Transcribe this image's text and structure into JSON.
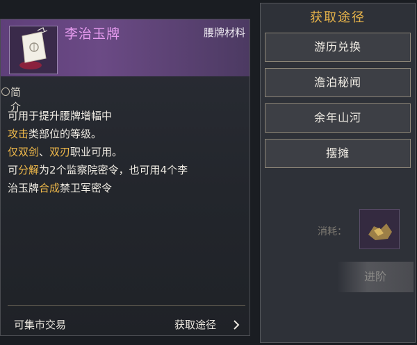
{
  "item": {
    "name": "李治玉牌",
    "category": "腰牌材料",
    "icon": "jade-token-icon",
    "intro_title": "简介",
    "description": [
      [
        {
          "text": "可用于提升腰牌增幅中",
          "hl": false
        }
      ],
      [
        {
          "text": "攻击",
          "hl": true
        },
        {
          "text": "类部位的等级。",
          "hl": false
        }
      ],
      [
        {
          "text": "仅双剑",
          "hl": true
        },
        {
          "text": "、",
          "hl": false
        },
        {
          "text": "双刃",
          "hl": true
        },
        {
          "text": "职业可用。",
          "hl": false
        }
      ],
      [
        {
          "text": "可",
          "hl": false
        },
        {
          "text": "分解",
          "hl": true
        },
        {
          "text": "为2个监察院密令，也可用4个李",
          "hl": false
        }
      ],
      [
        {
          "text": "治玉牌",
          "hl": false
        },
        {
          "text": "合成",
          "hl": true
        },
        {
          "text": "禁卫军密令",
          "hl": false
        }
      ]
    ],
    "footer": {
      "trade_label": "可集市交易",
      "source_label": "获取途径"
    }
  },
  "sources": {
    "title": "获取途径",
    "buttons": [
      "游历兑换",
      "澹泊秘闻",
      "余年山河",
      "摆摊"
    ],
    "consume_label": "消耗：",
    "consume_icon": "gold-ore-icon",
    "advance_label": "进阶"
  },
  "colors": {
    "item_name": "#e79cf0",
    "highlight": "#f0b94a",
    "source_title": "#e9b54a",
    "header_purple": "#6b4a85"
  }
}
